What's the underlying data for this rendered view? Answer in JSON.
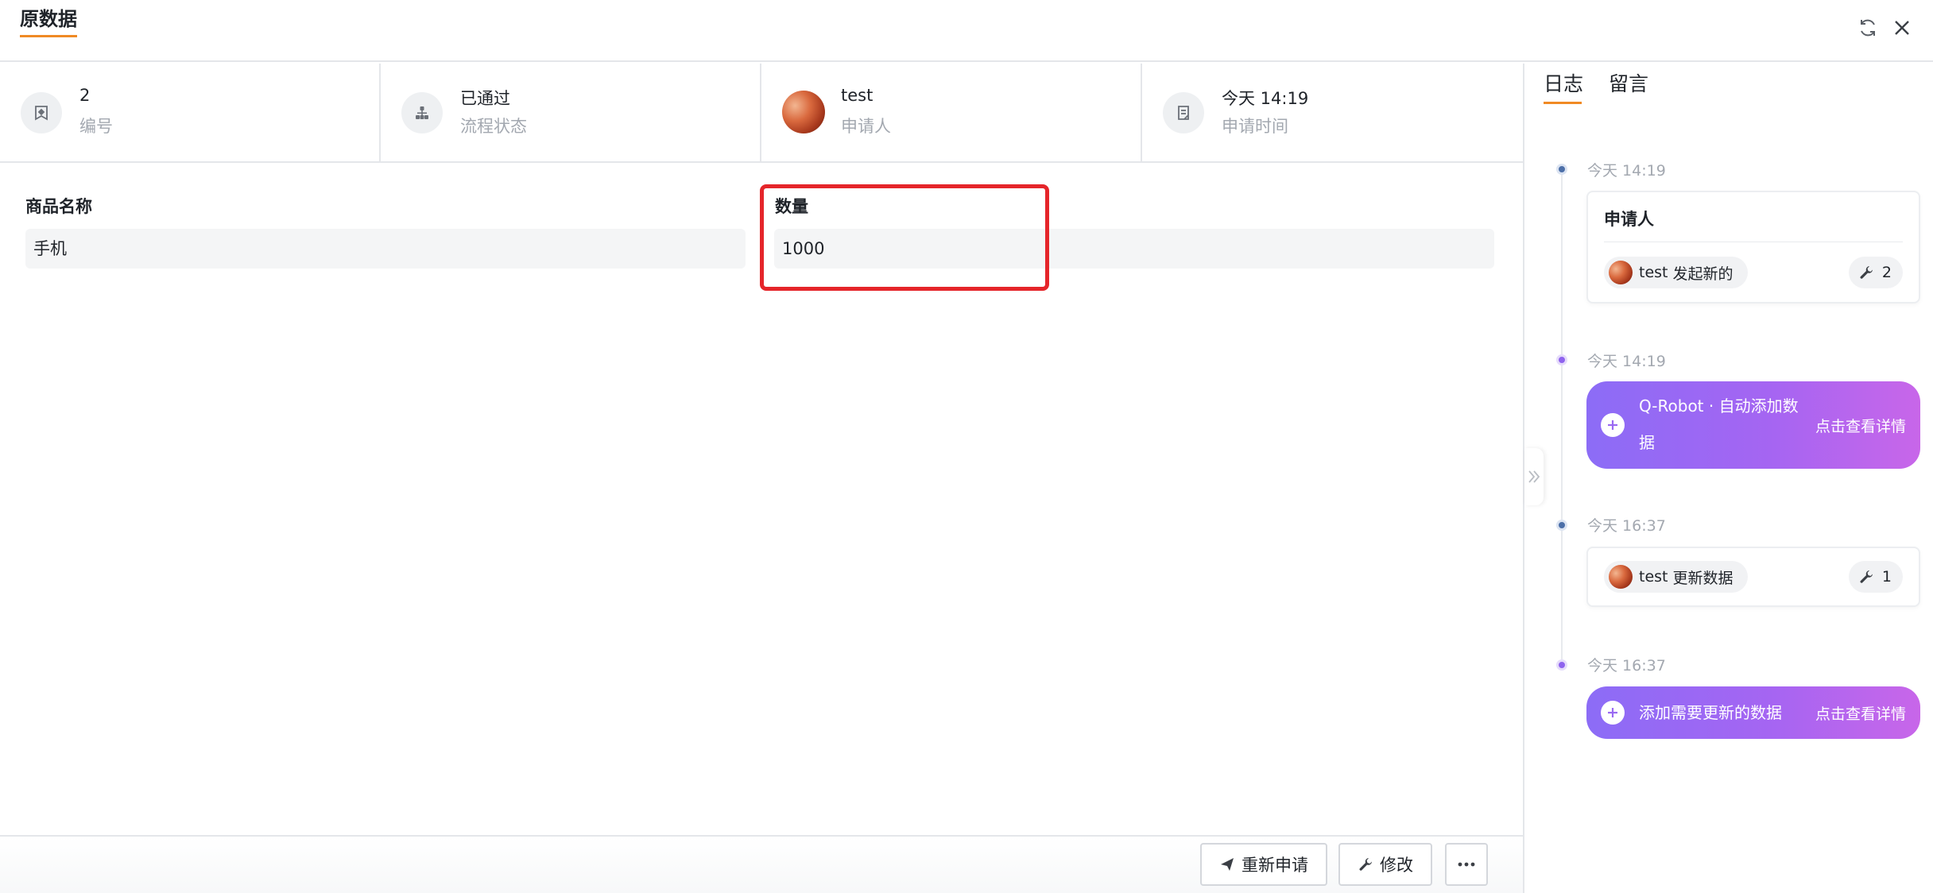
{
  "header": {
    "title": "原数据",
    "refresh_icon": "refresh-icon",
    "close_icon": "close-icon"
  },
  "info": [
    {
      "value": "2",
      "label": "编号",
      "icon": "bookmark-icon"
    },
    {
      "value": "已通过",
      "label": "流程状态",
      "icon": "workflow-icon"
    },
    {
      "value": "test",
      "label": "申请人",
      "icon": "avatar"
    },
    {
      "value": "今天 14:19",
      "label": "申请时间",
      "icon": "document-icon"
    }
  ],
  "form": {
    "fields": [
      {
        "label": "商品名称",
        "value": "手机"
      },
      {
        "label": "数量",
        "value": "1000"
      }
    ]
  },
  "panel": {
    "tabs": [
      {
        "label": "日志",
        "active": true
      },
      {
        "label": "留言",
        "active": false
      }
    ],
    "timeline": [
      {
        "time": "今天 14:19",
        "type": "card",
        "title": "申请人",
        "user": "test",
        "action": "发起新的",
        "count": "2"
      },
      {
        "time": "今天 14:19",
        "type": "robot",
        "text": "Q-Robot · 自动添加数据",
        "text_line1": "Q-Robot · 自动添加数",
        "text_line2": "据",
        "link": "点击查看详情"
      },
      {
        "time": "今天 16:37",
        "type": "card",
        "user": "test",
        "action": "更新数据",
        "count": "1"
      },
      {
        "time": "今天 16:37",
        "type": "robot",
        "text": "添加需要更新的数据",
        "link": "点击查看详情"
      }
    ]
  },
  "toolbar": {
    "reapply_label": "重新申请",
    "edit_label": "修改",
    "more_icon": "more-icon"
  },
  "colors": {
    "accent": "#f08a24",
    "highlight": "#e5252a",
    "robot_gradient_start": "#8c6cf6",
    "robot_gradient_end": "#c866e9"
  }
}
